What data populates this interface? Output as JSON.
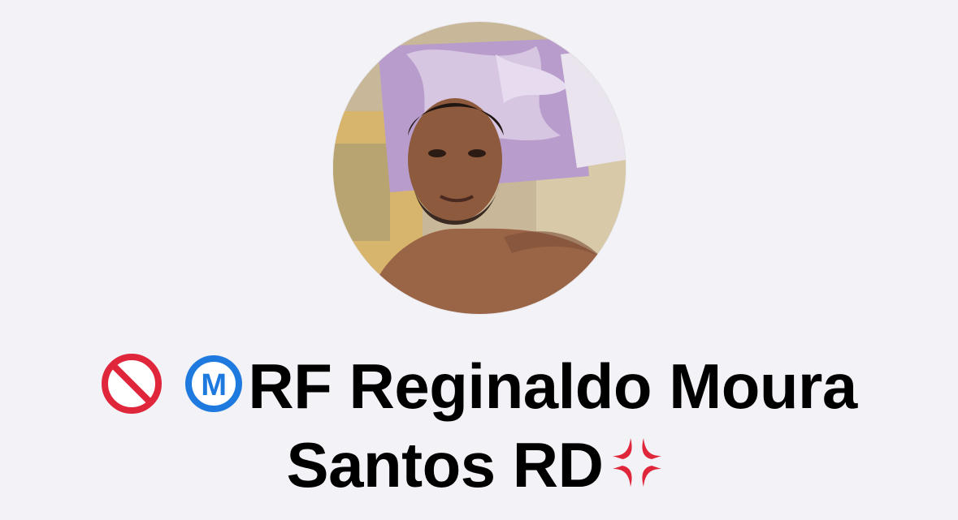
{
  "contact": {
    "name_line1_prefix_icons": [
      "no-entry-icon",
      "circled-m-icon"
    ],
    "name_line1_text": "RF Reginaldo Moura",
    "name_line2_text": "Santos RD",
    "name_line2_suffix_icon": "anger-symbol-icon",
    "avatar_alt": "profile photo"
  },
  "colors": {
    "background": "#f2f2f7",
    "text": "#000000",
    "no_entry_red": "#e0263a",
    "circled_m_blue": "#1f7ae0",
    "anger_red": "#e0263a"
  }
}
